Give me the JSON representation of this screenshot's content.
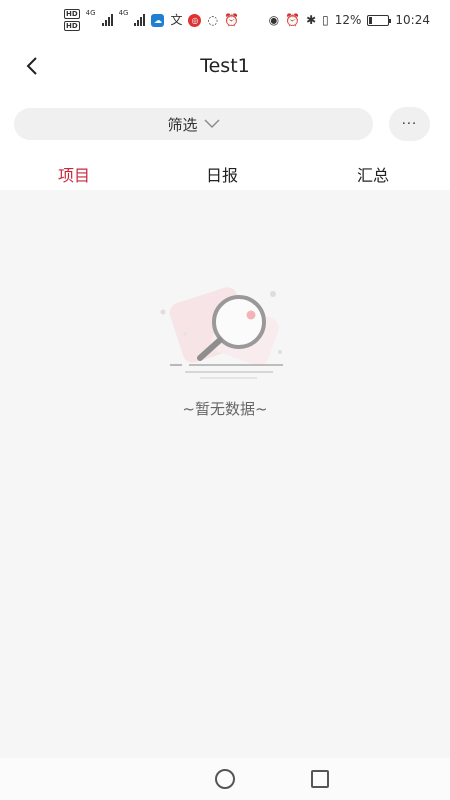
{
  "status_bar": {
    "net_label_1": "4G",
    "net_label_2": "4G",
    "battery_percent": "12%",
    "battery_level": 0.12,
    "time": "10:24",
    "icons": [
      "hd-icon",
      "signal-icon",
      "cloud-app-icon",
      "translate-icon",
      "app-icon",
      "chat-icon",
      "alarm-icon",
      "eye-icon",
      "alarm-icon",
      "bluetooth-icon",
      "vibrate-icon",
      "battery-icon"
    ]
  },
  "header": {
    "title": "Test1",
    "back_icon": "chevron-left-icon"
  },
  "filter": {
    "label": "筛选",
    "more_label": "···"
  },
  "tabs": [
    {
      "label": "项目",
      "active": true
    },
    {
      "label": "日报",
      "active": false
    },
    {
      "label": "汇总",
      "active": false
    }
  ],
  "empty_state": {
    "text": "~暂无数据~",
    "icon": "magnifier-icon"
  },
  "colors": {
    "accent": "#c8283c",
    "background": "#f6f6f6",
    "pill": "#f0f0f0"
  }
}
